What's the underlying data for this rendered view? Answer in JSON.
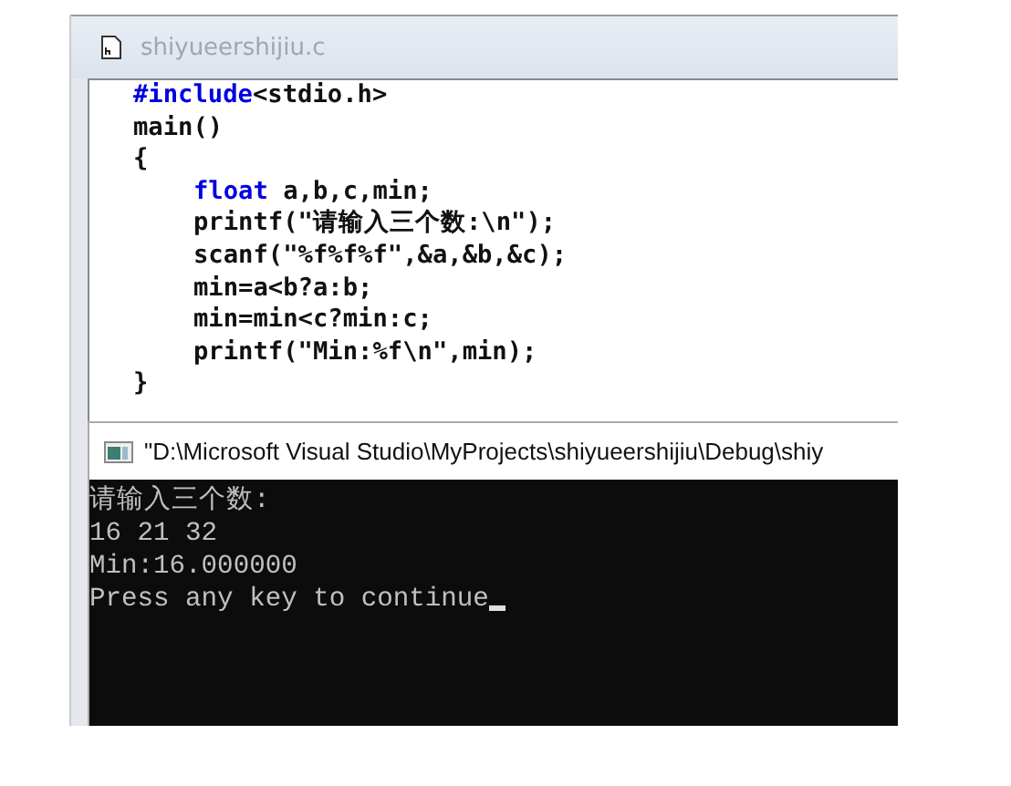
{
  "editor": {
    "title": "shiyueershijiu.c",
    "lines": [
      {
        "indented": false,
        "segments": [
          {
            "kind": "keyword",
            "text": "#include"
          },
          {
            "kind": "plain",
            "text": "<stdio.h>"
          }
        ]
      },
      {
        "indented": false,
        "segments": [
          {
            "kind": "plain",
            "text": "main()"
          }
        ]
      },
      {
        "indented": false,
        "segments": [
          {
            "kind": "plain",
            "text": "{"
          }
        ]
      },
      {
        "indented": true,
        "segments": [
          {
            "kind": "keyword",
            "text": "float"
          },
          {
            "kind": "plain",
            "text": " a,b,c,min;"
          }
        ]
      },
      {
        "indented": true,
        "segments": [
          {
            "kind": "plain",
            "text": "printf(\"请输入三个数:\\n\");"
          }
        ]
      },
      {
        "indented": true,
        "segments": [
          {
            "kind": "plain",
            "text": "scanf(\"%f%f%f\",&a,&b,&c);"
          }
        ]
      },
      {
        "indented": true,
        "segments": [
          {
            "kind": "plain",
            "text": "min=a<b?a:b;"
          }
        ]
      },
      {
        "indented": true,
        "segments": [
          {
            "kind": "plain",
            "text": "min=min<c?min:c;"
          }
        ]
      },
      {
        "indented": true,
        "segments": [
          {
            "kind": "plain",
            "text": "printf(\"Min:%f\\n\",min);"
          }
        ]
      },
      {
        "indented": false,
        "segments": [
          {
            "kind": "plain",
            "text": "}"
          }
        ]
      }
    ]
  },
  "console": {
    "title": "\"D:\\Microsoft Visual Studio\\MyProjects\\shiyueershijiu\\Debug\\shiy",
    "lines": [
      "请输入三个数:",
      "16 21 32",
      "Min:16.000000",
      "Press any key to continue"
    ],
    "cursor": true
  }
}
